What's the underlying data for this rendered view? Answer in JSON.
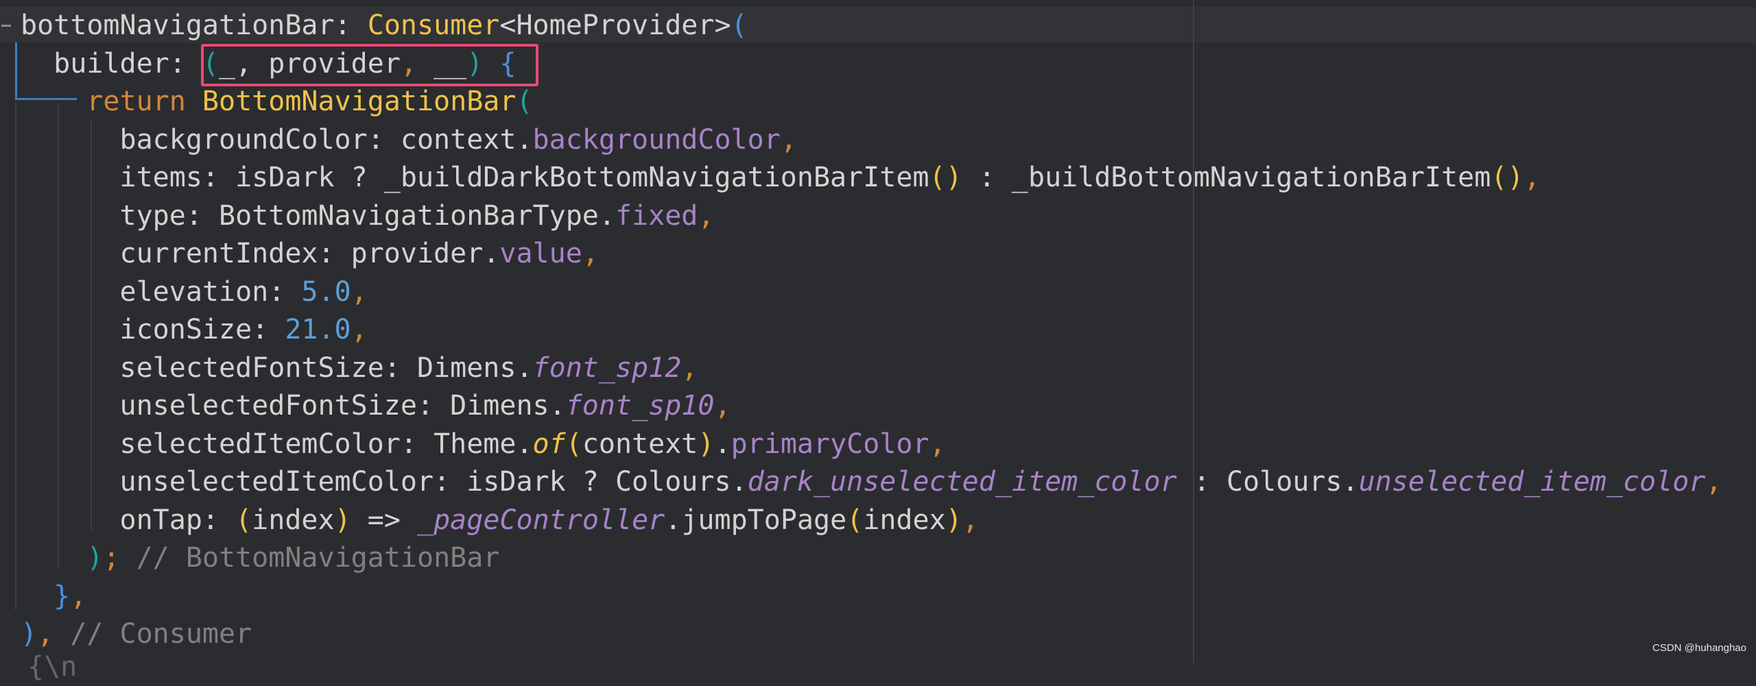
{
  "editor": {
    "theme_colors": {
      "background": "#2b2c2f",
      "plain": "#d3d3d3",
      "keyword": "#d6863a",
      "class_name": "#f0c24a",
      "property": "#a883c9",
      "number": "#5e9fd6",
      "comment": "#808080",
      "bracket_teal": "#23a29a",
      "bracket_blue": "#4a90e2",
      "bracket_yellow": "#f0c24a",
      "highlight_border": "#e84a78"
    },
    "lines": [
      [
        {
          "t": "bottomNavigationBar: ",
          "c": "plain"
        },
        {
          "t": "Consumer",
          "c": "class_name"
        },
        {
          "t": "<HomeProvider>",
          "c": "plain"
        },
        {
          "t": "(",
          "c": "bracket_blue"
        }
      ],
      [
        {
          "t": "  builder: ",
          "c": "plain"
        },
        {
          "t": "(",
          "c": "bracket_teal"
        },
        {
          "t": "_, provider",
          "c": "plain"
        },
        {
          "t": ", ",
          "c": "keyword"
        },
        {
          "t": "__",
          "c": "plain"
        },
        {
          "t": ")",
          "c": "bracket_teal"
        },
        {
          "t": " {",
          "c": "bracket_blue"
        }
      ],
      [
        {
          "t": "    return ",
          "c": "keyword"
        },
        {
          "t": "BottomNavigationBar",
          "c": "class_name"
        },
        {
          "t": "(",
          "c": "bracket_teal"
        }
      ],
      [
        {
          "t": "      backgroundColor: context.",
          "c": "plain"
        },
        {
          "t": "backgroundColor",
          "c": "property"
        },
        {
          "t": ",",
          "c": "keyword"
        }
      ],
      [
        {
          "t": "      items: isDark ? _buildDarkBottomNavigationBarItem",
          "c": "plain"
        },
        {
          "t": "()",
          "c": "bracket_yellow"
        },
        {
          "t": " : _buildBottomNavigationBarItem",
          "c": "plain"
        },
        {
          "t": "()",
          "c": "bracket_yellow"
        },
        {
          "t": ",",
          "c": "keyword"
        }
      ],
      [
        {
          "t": "      type: BottomNavigationBarType.",
          "c": "plain"
        },
        {
          "t": "fixed",
          "c": "property"
        },
        {
          "t": ",",
          "c": "keyword"
        }
      ],
      [
        {
          "t": "      currentIndex: provider.",
          "c": "plain"
        },
        {
          "t": "value",
          "c": "property"
        },
        {
          "t": ",",
          "c": "keyword"
        }
      ],
      [
        {
          "t": "      elevation: ",
          "c": "plain"
        },
        {
          "t": "5.0",
          "c": "number"
        },
        {
          "t": ",",
          "c": "keyword"
        }
      ],
      [
        {
          "t": "      iconSize: ",
          "c": "plain"
        },
        {
          "t": "21.0",
          "c": "number"
        },
        {
          "t": ",",
          "c": "keyword"
        }
      ],
      [
        {
          "t": "      selectedFontSize: Dimens.",
          "c": "plain"
        },
        {
          "t": "font_sp12",
          "c": "property",
          "i": true
        },
        {
          "t": ",",
          "c": "keyword"
        }
      ],
      [
        {
          "t": "      unselectedFontSize: Dimens.",
          "c": "plain"
        },
        {
          "t": "font_sp10",
          "c": "property",
          "i": true
        },
        {
          "t": ",",
          "c": "keyword"
        }
      ],
      [
        {
          "t": "      selectedItemColor: Theme.",
          "c": "plain"
        },
        {
          "t": "of",
          "c": "class_name",
          "i": true
        },
        {
          "t": "(",
          "c": "bracket_yellow"
        },
        {
          "t": "context",
          "c": "plain"
        },
        {
          "t": ")",
          "c": "bracket_yellow"
        },
        {
          "t": ".",
          "c": "plain"
        },
        {
          "t": "primaryColor",
          "c": "property"
        },
        {
          "t": ",",
          "c": "keyword"
        }
      ],
      [
        {
          "t": "      unselectedItemColor: isDark ? Colours.",
          "c": "plain"
        },
        {
          "t": "dark_unselected_item_color",
          "c": "property",
          "i": true
        },
        {
          "t": " : Colours.",
          "c": "plain"
        },
        {
          "t": "unselected_item_color",
          "c": "property",
          "i": true
        },
        {
          "t": ",",
          "c": "keyword"
        }
      ],
      [
        {
          "t": "      onTap: ",
          "c": "plain"
        },
        {
          "t": "(",
          "c": "bracket_yellow"
        },
        {
          "t": "index",
          "c": "plain"
        },
        {
          "t": ")",
          "c": "bracket_yellow"
        },
        {
          "t": " => ",
          "c": "plain"
        },
        {
          "t": "_pageController",
          "c": "property",
          "i": true
        },
        {
          "t": ".jumpToPage",
          "c": "plain"
        },
        {
          "t": "(",
          "c": "bracket_yellow"
        },
        {
          "t": "index",
          "c": "plain"
        },
        {
          "t": ")",
          "c": "bracket_yellow"
        },
        {
          "t": ",",
          "c": "keyword"
        }
      ],
      [
        {
          "t": "    ",
          "c": "plain"
        },
        {
          "t": ")",
          "c": "bracket_teal"
        },
        {
          "t": "; ",
          "c": "keyword"
        },
        {
          "t": "// BottomNavigationBar",
          "c": "comment"
        }
      ],
      [
        {
          "t": "  ",
          "c": "plain"
        },
        {
          "t": "}",
          "c": "bracket_blue"
        },
        {
          "t": ",",
          "c": "keyword"
        }
      ],
      [
        {
          "t": ")",
          "c": "bracket_blue"
        },
        {
          "t": ", ",
          "c": "keyword"
        },
        {
          "t": "// Consumer",
          "c": "comment"
        }
      ]
    ]
  },
  "watermark": "CSDN @huhanghao"
}
